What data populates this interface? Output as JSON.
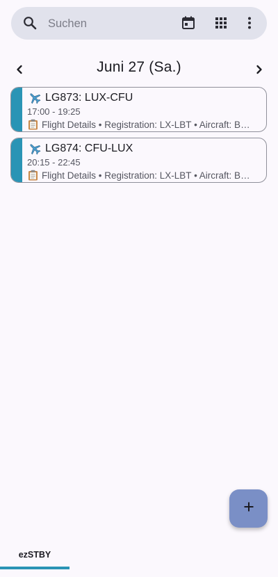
{
  "search": {
    "placeholder": "Suchen",
    "icons": [
      "search-icon",
      "calendar-icon",
      "apps-grid-icon",
      "more-vert-icon"
    ]
  },
  "date_nav": {
    "title": "Juni 27 (Sa.)",
    "prev_icon": "chevron-left-icon",
    "next_icon": "chevron-right-icon"
  },
  "flights": [
    {
      "title": "LG873: LUX-CFU",
      "time": "17:00 - 19:25",
      "details": "Flight Details • Registration: LX-LBT • Aircraft: Boeing"
    },
    {
      "title": "LG874: CFU-LUX",
      "time": "20:15 - 22:45",
      "details": "Flight Details • Registration: LX-LBT • Aircraft: Boeing"
    }
  ],
  "fab": {
    "icon": "plus-icon"
  },
  "tabs": [
    {
      "label": "ezSTBY",
      "selected": true
    }
  ],
  "colors": {
    "background": "#fbf8fd",
    "search_bar": "#e1e2ec",
    "accent": "#2a94b5",
    "fab": "#7a8fc6"
  }
}
